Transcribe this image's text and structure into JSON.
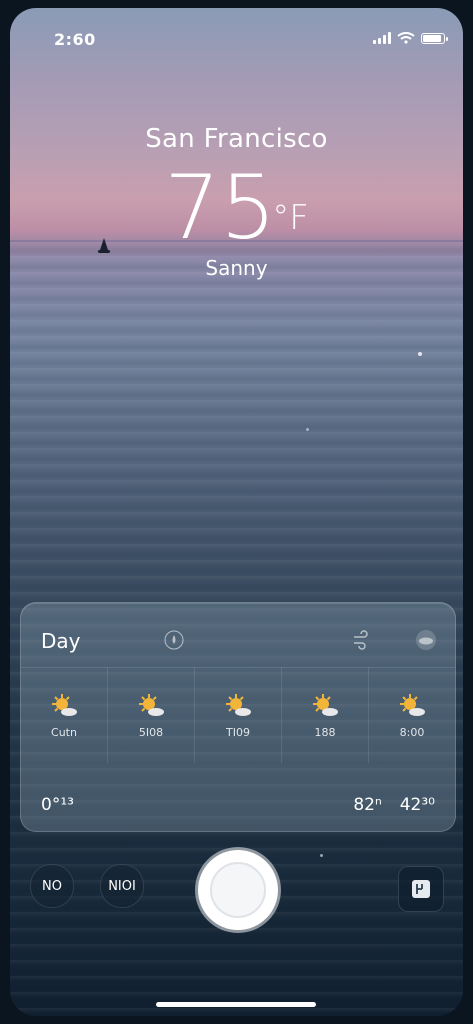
{
  "status_bar": {
    "time": "2:60"
  },
  "header": {
    "city": "San Francisco",
    "temperature": "75",
    "unit": "°F",
    "condition": "Sanny"
  },
  "forecast_panel": {
    "title": "Day",
    "columns": [
      {
        "icon": "sun-cloud-icon",
        "label": "Cutn"
      },
      {
        "icon": "sun-cloud-icon",
        "label": "5I08"
      },
      {
        "icon": "sun-cloud-icon",
        "label": "TI09"
      },
      {
        "icon": "sun-cloud-icon",
        "label": "188"
      },
      {
        "icon": "sun-cloud-icon",
        "label": "8:00"
      }
    ],
    "footer_left": "0°¹³",
    "footer_right_1": "82ⁿ",
    "footer_right_2": "42³⁰"
  },
  "controls": {
    "left_btn_1": "NO",
    "left_btn_2": "NIOI"
  },
  "colors": {
    "sun": "#f2b53a",
    "cloud": "#e8e8ea",
    "panel": "rgba(150,170,190,0.32)"
  }
}
